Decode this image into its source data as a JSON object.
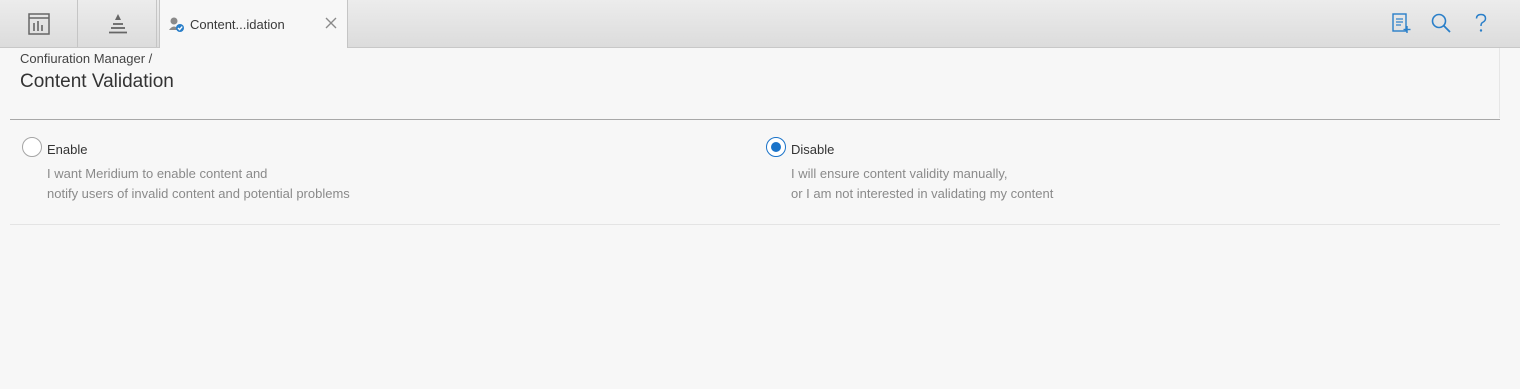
{
  "tabs": {
    "icon_tab_1": "dashboard-icon",
    "icon_tab_2": "hierarchy-icon",
    "active_tab": {
      "label": "Content...idation",
      "icon": "content-validation-icon",
      "close_icon": "close-icon"
    }
  },
  "toolbar": {
    "tools": [
      "add-note-icon",
      "search-icon",
      "help-icon"
    ]
  },
  "header": {
    "breadcrumb": "Confiuration Manager /",
    "title": "Content Validation"
  },
  "options": {
    "enable": {
      "label": "Enable",
      "line1": "I want Meridium to enable content and",
      "line2": "notify users of invalid content and potential problems",
      "selected": false
    },
    "disable": {
      "label": "Disable",
      "line1": "I will ensure content validity manually,",
      "line2": "or I am not interested in validating my content",
      "selected": true
    }
  },
  "colors": {
    "accent": "#1a73c9",
    "background": "#f7f7f7"
  }
}
